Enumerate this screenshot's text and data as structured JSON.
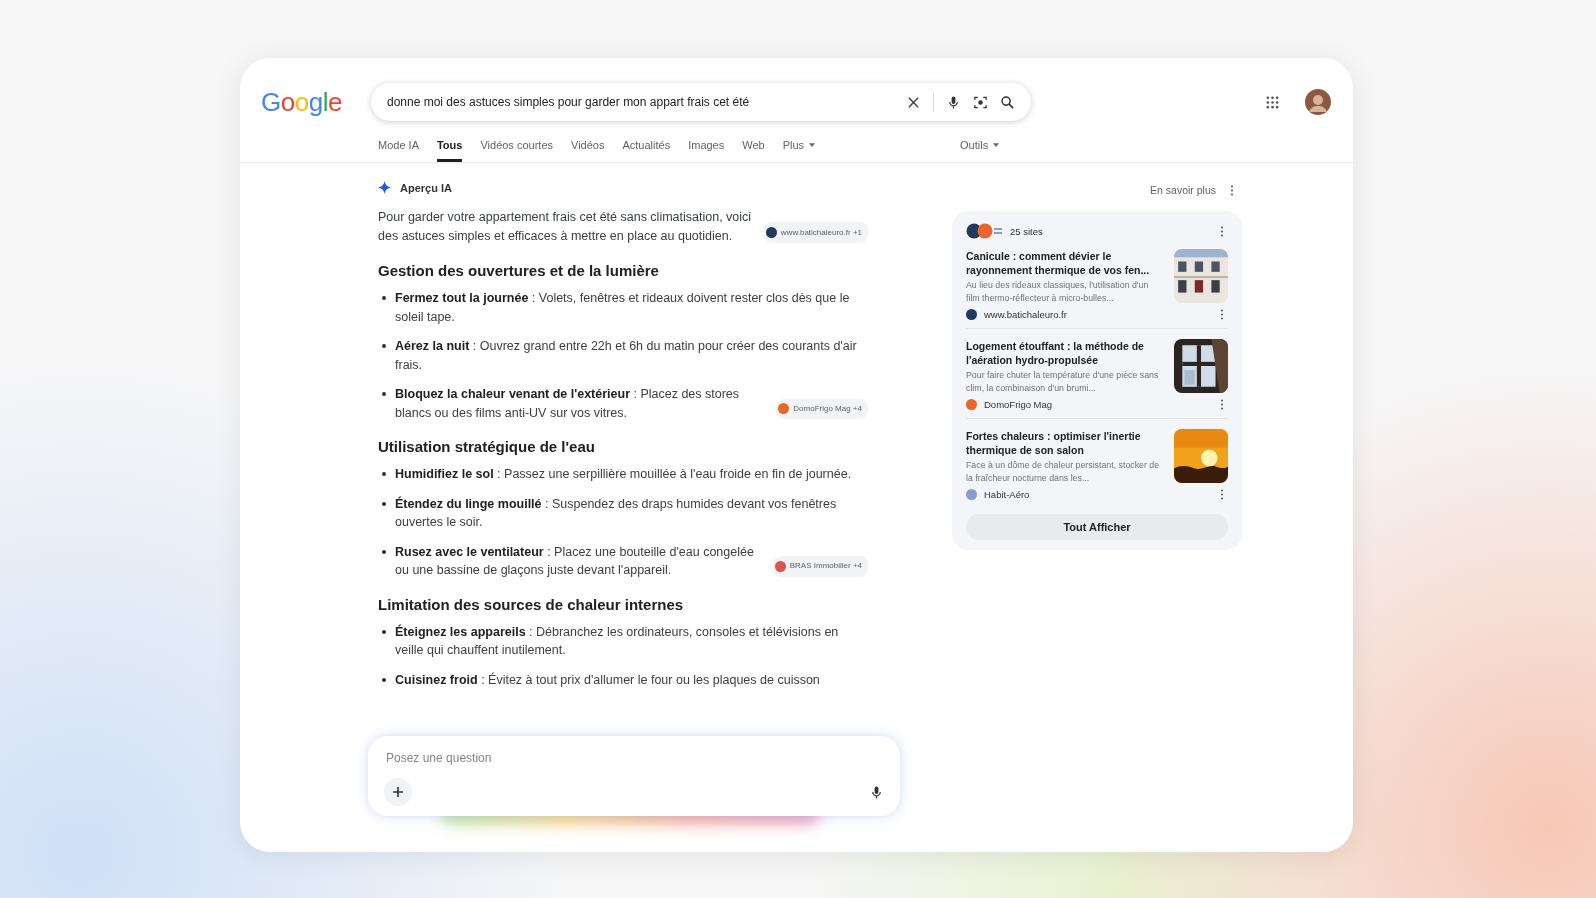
{
  "search": {
    "logo": "Google",
    "query": "donne moi des astuces simples pour garder mon appart frais cet été"
  },
  "tabs": [
    {
      "label": "Mode IA",
      "selected": false
    },
    {
      "label": "Tous",
      "selected": true
    },
    {
      "label": "Vidéos courtes",
      "selected": false
    },
    {
      "label": "Vidéos",
      "selected": false
    },
    {
      "label": "Actualités",
      "selected": false
    },
    {
      "label": "Images",
      "selected": false
    },
    {
      "label": "Web",
      "selected": false
    },
    {
      "label": "Plus",
      "selected": false,
      "kind": "menu"
    }
  ],
  "tools": {
    "label": "Outils"
  },
  "overview": {
    "title": "Aperçu IA",
    "learn_more": "En savoir plus",
    "intro": "Pour garder votre appartement frais cet été sans climatisation, voici des astuces simples et efficaces à mettre en place au quotidien.",
    "intro_source": {
      "label": "www.batichaleuro.fr +1",
      "color": "#23395b"
    },
    "sections": [
      {
        "heading": "Gestion des ouvertures et de la lumière",
        "items": [
          {
            "text": "**Fermez tout la journée** : Volets, fenêtres et rideaux doivent rester clos dès que le soleil tape."
          },
          {
            "text": "**Aérez la nuit** : Ouvrez grand entre 22h et 6h du matin pour créer des courants d'air frais."
          },
          {
            "text": "**Bloquez la chaleur venant de l'extérieur** : Placez des stores blancs ou des films anti-UV sur vos vitres.",
            "source": {
              "label": "DomoFrigo Mag +4",
              "color": "#e8652b"
            }
          }
        ]
      },
      {
        "heading": "Utilisation stratégique de l'eau",
        "items": [
          {
            "text": "**Humidifiez le sol** : Passez une serpillière mouillée à l'eau froide en fin de journée."
          },
          {
            "text": "**Étendez du linge mouillé** : Suspendez des draps humides devant vos fenêtres ouvertes le soir."
          },
          {
            "text": "**Rusez avec le ventilateur** : Placez une bouteille d'eau congelée ou une bassine de glaçons juste devant l'appareil.",
            "source": {
              "label": "BRAS Immobilier +4",
              "color": "#d9534f"
            }
          }
        ]
      },
      {
        "heading": "Limitation des sources de chaleur internes",
        "items": [
          {
            "text": "**Éteignez les appareils** : Débranchez les ordinateurs, consoles et télévisions en veille qui chauffent inutilement."
          },
          {
            "text": "**Cuisinez froid** : Évitez à tout prix d'allumer le four ou les plaques de cuisson"
          }
        ]
      }
    ]
  },
  "sources": {
    "count": "25 sites",
    "show_all": "Tout Afficher",
    "articles": [
      {
        "title": "Canicule : comment dévier le rayonnement thermique de vos fen...",
        "snippet": "Au lieu des rideaux classiques, l'utilisation d'un film thermo-réflecteur à micro-bulles...",
        "site": "www.batichaleuro.fr",
        "color": "#23395b"
      },
      {
        "title": "Logement étouffant : la méthode de l'aération hydro-propulsée",
        "snippet": "Pour faire chuter la température d'une pièce sans clim, la combinaison d'un brumi...",
        "site": "DomoFrigo Mag",
        "color": "#e8652b"
      },
      {
        "title": "Fortes chaleurs : optimiser l'inertie thermique de son salon",
        "snippet": "Face à un dôme de chaleur persistant, stocker de la fraîcheur nocturne dans les...",
        "site": "Habit-Aéro",
        "color": "#8a9bd0"
      }
    ]
  },
  "ask": {
    "placeholder": "Posez une question"
  }
}
